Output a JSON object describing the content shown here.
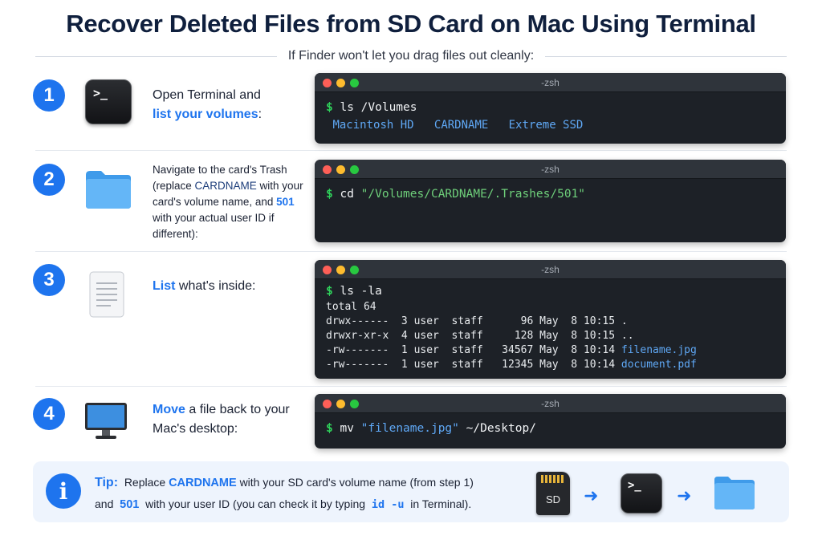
{
  "header": {
    "title": "Recover Deleted Files from SD Card on Mac Using Terminal",
    "subtitle": "If Finder won't let you drag files out cleanly:"
  },
  "steps": [
    {
      "number": "1",
      "icon": "terminal-app-icon",
      "text_plain": "Open Terminal and",
      "text_highlight": "list your volumes",
      "text_tail": ":",
      "terminal": {
        "title": "-zsh",
        "prompt": "$",
        "command": "ls /Volumes",
        "volumes": [
          "Macintosh HD",
          "CARDNAME",
          "Extreme SSD"
        ]
      }
    },
    {
      "number": "2",
      "icon": "folder-icon",
      "text_a": "Navigate to the card's Trash (replace ",
      "text_b": "CARDNAME",
      "text_c": " with your card's volume name, and ",
      "text_d": "501",
      "text_e": " with your actual user ID if different):",
      "terminal": {
        "title": "-zsh",
        "prompt": "$",
        "command": "cd",
        "argument": "\"/Volumes/CARDNAME/.Trashes/501\""
      }
    },
    {
      "number": "3",
      "icon": "document-icon",
      "text_highlight": "List",
      "text_plain": " what's inside:",
      "terminal": {
        "title": "-zsh",
        "prompt": "$",
        "command": "ls -la",
        "total": "total 64",
        "listing": [
          {
            "perms": "drwx------ ",
            "links": " 3",
            "user": "user",
            "group": "staff",
            "size": "   96",
            "month": "May",
            "day": " 8",
            "time": "10:15",
            "name": "."
          },
          {
            "perms": "drwxr-xr-x ",
            "links": " 4",
            "user": "user",
            "group": "staff",
            "size": "  128",
            "month": "May",
            "day": " 8",
            "time": "10:15",
            "name": ".."
          },
          {
            "perms": "-rw------- ",
            "links": " 1",
            "user": "user",
            "group": "staff",
            "size": "34567",
            "month": "May",
            "day": " 8",
            "time": "10:14",
            "name": "filename.jpg"
          },
          {
            "perms": "-rw------- ",
            "links": " 1",
            "user": "user",
            "group": "staff",
            "size": "12345",
            "month": "May",
            "day": " 8",
            "time": "10:14",
            "name": "document.pdf"
          }
        ]
      }
    },
    {
      "number": "4",
      "icon": "desktop-monitor-icon",
      "text_highlight": "Move",
      "text_plain": " a file back to your Mac's desktop:",
      "terminal": {
        "title": "-zsh",
        "prompt": "$",
        "command": "mv",
        "argument": "\"filename.jpg\"",
        "destination": "~/Desktop/"
      }
    }
  ],
  "tip": {
    "icon": "info-icon",
    "lead": "Tip:",
    "l1_a": "Replace",
    "l1_kw": "CARDNAME",
    "l1_b": "with your SD card's volume name (from step 1)",
    "l2_a": "and",
    "l2_kw": "501",
    "l2_b": "with your user ID (you can check it by typing",
    "l2_cmd": "id -u",
    "l2_c": "in Terminal).",
    "flow": {
      "sd_label": "SD",
      "icons": [
        "sd-card-icon",
        "arrow-right-icon",
        "terminal-app-icon",
        "arrow-right-icon",
        "folder-icon"
      ]
    }
  },
  "colors": {
    "accent": "#1e74ee",
    "terminal_bg": "#1d2127",
    "prompt_green": "#2fd35b",
    "file_blue": "#5fa8f5"
  }
}
